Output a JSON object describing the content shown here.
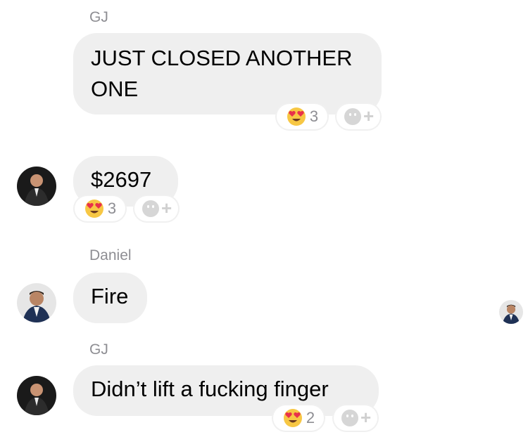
{
  "messages": [
    {
      "sender": "GJ",
      "text": "JUST CLOSED ANOTHER ONE",
      "text_lines": [
        "JUST CLOSED ANOTHER",
        "ONE"
      ],
      "reaction": {
        "emoji": "heart-eyes-emoji",
        "count": "3"
      }
    },
    {
      "sender": "",
      "text": "$2697",
      "reaction": {
        "emoji": "heart-eyes-emoji",
        "count": "3"
      }
    },
    {
      "sender": "Daniel",
      "text": "Fire"
    },
    {
      "sender": "GJ",
      "text": "Didn’t lift a fucking finger",
      "reaction": {
        "emoji": "heart-eyes-emoji",
        "count": "2"
      }
    }
  ],
  "icons": {
    "add_reaction": "smiley-plus-icon",
    "seen_receipt": "avatar-seen-icon"
  },
  "colors": {
    "bubble": "#efefef",
    "sender_text": "#8e8e93",
    "background": "#ffffff"
  }
}
